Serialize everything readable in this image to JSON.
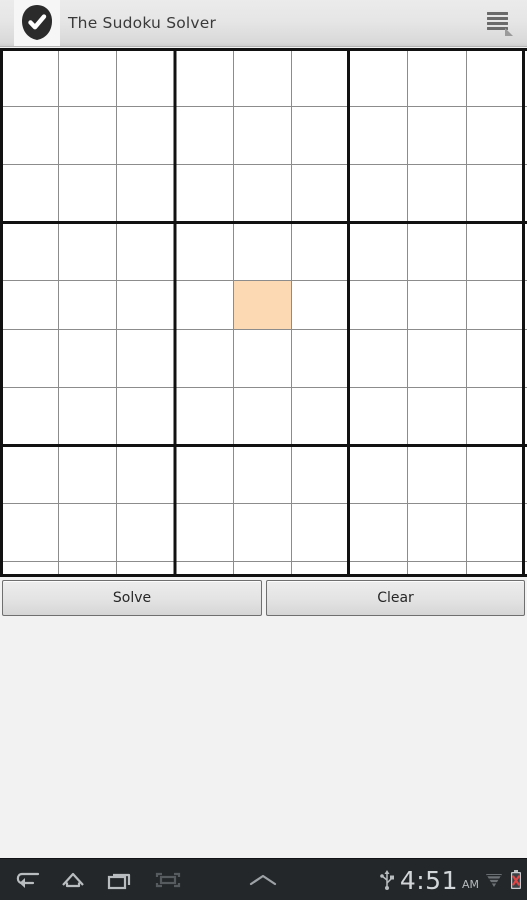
{
  "app": {
    "title": "The Sudoku Solver",
    "icon_name": "check-badge-icon",
    "menu_icon_name": "hamburger-menu-icon",
    "titlebar_bg": "#E6E6E6",
    "background": "#F2F2F2"
  },
  "board": {
    "name": "sudoku-grid",
    "size": 9,
    "box_size": 3,
    "thin_line_color": "#8C8C8C",
    "thick_line_color": "#111111",
    "cell_fill": "#FFFFFF",
    "selected_cell_color": "#FCD9B2",
    "selected_cell": {
      "row": 4,
      "col": 4
    },
    "cells": [
      [
        "",
        "",
        "",
        "",
        "",
        "",
        "",
        "",
        ""
      ],
      [
        "",
        "",
        "",
        "",
        "",
        "",
        "",
        "",
        ""
      ],
      [
        "",
        "",
        "",
        "",
        "",
        "",
        "",
        "",
        ""
      ],
      [
        "",
        "",
        "",
        "",
        "",
        "",
        "",
        "",
        ""
      ],
      [
        "",
        "",
        "",
        "",
        "",
        "",
        "",
        "",
        ""
      ],
      [
        "",
        "",
        "",
        "",
        "",
        "",
        "",
        "",
        ""
      ],
      [
        "",
        "",
        "",
        "",
        "",
        "",
        "",
        "",
        ""
      ],
      [
        "",
        "",
        "",
        "",
        "",
        "",
        "",
        "",
        ""
      ],
      [
        "",
        "",
        "",
        "",
        "",
        "",
        "",
        "",
        ""
      ]
    ]
  },
  "buttons": {
    "solve_label": "Solve",
    "clear_label": "Clear"
  },
  "navbar": {
    "background": "#24272A",
    "back_icon": "back-arrow-icon",
    "home_icon": "home-icon",
    "recents_icon": "recent-apps-icon",
    "screenshot_icon": "screenshot-icon",
    "chevron_icon": "chevron-up-icon",
    "usb_icon": "usb-icon",
    "wifi_icon": "wifi-signal-icon",
    "battery_icon": "battery-error-icon",
    "time": "4:51",
    "ampm": "AM"
  }
}
